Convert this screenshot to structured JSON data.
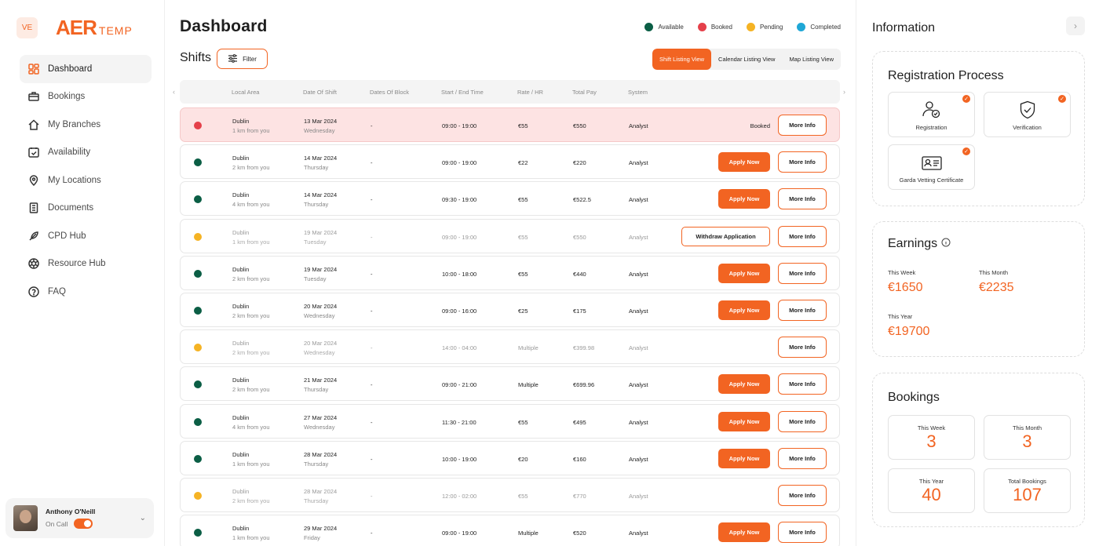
{
  "brand": {
    "badge": "VE",
    "logo_mark": "AER",
    "logo_text": "TEMP",
    "accent": "#f26422"
  },
  "sidebar": {
    "items": [
      {
        "label": "Dashboard",
        "icon": "dashboard-icon",
        "active": true
      },
      {
        "label": "Bookings",
        "icon": "briefcase-icon"
      },
      {
        "label": "My Branches",
        "icon": "home-icon"
      },
      {
        "label": "Availability",
        "icon": "calendar-check-icon"
      },
      {
        "label": "My Locations",
        "icon": "location-pin-icon"
      },
      {
        "label": "Documents",
        "icon": "document-icon"
      },
      {
        "label": "CPD Hub",
        "icon": "feather-icon"
      },
      {
        "label": "Resource Hub",
        "icon": "aperture-icon"
      },
      {
        "label": "FAQ",
        "icon": "help-circle-icon"
      }
    ],
    "user": {
      "name": "Anthony O'Neill",
      "status": "On Call"
    }
  },
  "header": {
    "title": "Dashboard"
  },
  "legend": [
    {
      "label": "Available",
      "color": "#0b5e45"
    },
    {
      "label": "Booked",
      "color": "#e5404a"
    },
    {
      "label": "Pending",
      "color": "#f5b324"
    },
    {
      "label": "Completed",
      "color": "#1fa7d6"
    }
  ],
  "shifts": {
    "title": "Shifts",
    "filter_label": "Filter",
    "views": [
      "Shift Listing View",
      "Calendar Listing View",
      "Map Listing View"
    ],
    "columns": [
      "Local Area",
      "Date Of Shift",
      "Dates Of Block",
      "Start / End Time",
      "Rate / HR",
      "Total Pay",
      "System"
    ],
    "rows": [
      {
        "status": "booked",
        "city": "Dublin",
        "distance": "1 km from you",
        "date": "13 Mar 2024",
        "day": "Wednesday",
        "block": "-",
        "time": "09:00 - 19:00",
        "rate": "€55",
        "total": "€550",
        "system": "Analyst",
        "action": "Booked",
        "more": "More Info"
      },
      {
        "status": "available",
        "city": "Dublin",
        "distance": "2 km from you",
        "date": "14 Mar 2024",
        "day": "Thursday",
        "block": "-",
        "time": "09:00 - 19:00",
        "rate": "€22",
        "total": "€220",
        "system": "Analyst",
        "action": "Apply Now",
        "more": "More Info"
      },
      {
        "status": "available",
        "city": "Dublin",
        "distance": "4 km from you",
        "date": "14 Mar 2024",
        "day": "Thursday",
        "block": "-",
        "time": "09:30 - 19:00",
        "rate": "€55",
        "total": "€522.5",
        "system": "Analyst",
        "action": "Apply Now",
        "more": "More Info"
      },
      {
        "status": "pending",
        "city": "Dublin",
        "distance": "1 km from you",
        "date": "19 Mar 2024",
        "day": "Tuesday",
        "block": "-",
        "time": "09:00 - 19:00",
        "rate": "€55",
        "total": "€550",
        "system": "Analyst",
        "action": "Withdraw Application",
        "more": "More Info"
      },
      {
        "status": "available",
        "city": "Dublin",
        "distance": "2 km from you",
        "date": "19 Mar 2024",
        "day": "Tuesday",
        "block": "-",
        "time": "10:00 - 18:00",
        "rate": "€55",
        "total": "€440",
        "system": "Analyst",
        "action": "Apply Now",
        "more": "More Info"
      },
      {
        "status": "available",
        "city": "Dublin",
        "distance": "2 km from you",
        "date": "20 Mar 2024",
        "day": "Wednesday",
        "block": "-",
        "time": "09:00 - 16:00",
        "rate": "€25",
        "total": "€175",
        "system": "Analyst",
        "action": "Apply Now",
        "more": "More Info"
      },
      {
        "status": "pending",
        "city": "Dublin",
        "distance": "2 km from you",
        "date": "20 Mar 2024",
        "day": "Wednesday",
        "block": "-",
        "time": "14:00 - 04:00",
        "rate": "Multiple",
        "total": "€399.98",
        "system": "Analyst",
        "action": "",
        "more": "More Info"
      },
      {
        "status": "available",
        "city": "Dublin",
        "distance": "2 km from you",
        "date": "21 Mar 2024",
        "day": "Thursday",
        "block": "-",
        "time": "09:00 - 21:00",
        "rate": "Multiple",
        "total": "€699.96",
        "system": "Analyst",
        "action": "Apply Now",
        "more": "More Info"
      },
      {
        "status": "available",
        "city": "Dublin",
        "distance": "4 km from you",
        "date": "27 Mar 2024",
        "day": "Wednesday",
        "block": "-",
        "time": "11:30 - 21:00",
        "rate": "€55",
        "total": "€495",
        "system": "Analyst",
        "action": "Apply Now",
        "more": "More Info"
      },
      {
        "status": "available",
        "city": "Dublin",
        "distance": "1 km from you",
        "date": "28 Mar 2024",
        "day": "Thursday",
        "block": "-",
        "time": "10:00 - 19:00",
        "rate": "€20",
        "total": "€160",
        "system": "Analyst",
        "action": "Apply Now",
        "more": "More Info"
      },
      {
        "status": "pending",
        "city": "Dublin",
        "distance": "2 km from you",
        "date": "28 Mar 2024",
        "day": "Thursday",
        "block": "-",
        "time": "12:00 - 02:00",
        "rate": "€55",
        "total": "€770",
        "system": "Analyst",
        "action": "",
        "more": "More Info"
      },
      {
        "status": "available",
        "city": "Dublin",
        "distance": "1 km from you",
        "date": "29 Mar 2024",
        "day": "Friday",
        "block": "-",
        "time": "09:00 - 19:00",
        "rate": "Multiple",
        "total": "€520",
        "system": "Analyst",
        "action": "Apply Now",
        "more": "More Info"
      }
    ]
  },
  "info": {
    "title": "Information",
    "registration": {
      "title": "Registration Process",
      "steps": [
        {
          "label": "Registration",
          "icon": "user-check-icon",
          "done": true
        },
        {
          "label": "Verification",
          "icon": "shield-check-icon",
          "done": true
        },
        {
          "label": "Garda Vetting Certificate",
          "icon": "id-card-icon",
          "done": true
        }
      ]
    },
    "earnings": {
      "title": "Earnings",
      "week_label": "This Week",
      "week": "€1650",
      "month_label": "This Month",
      "month": "€2235",
      "year_label": "This Year",
      "year": "€19700"
    },
    "bookings": {
      "title": "Bookings",
      "week_label": "This Week",
      "week": "3",
      "month_label": "This Month",
      "month": "3",
      "year_label": "This Year",
      "year": "40",
      "total_label": "Total Bookings",
      "total": "107"
    }
  }
}
